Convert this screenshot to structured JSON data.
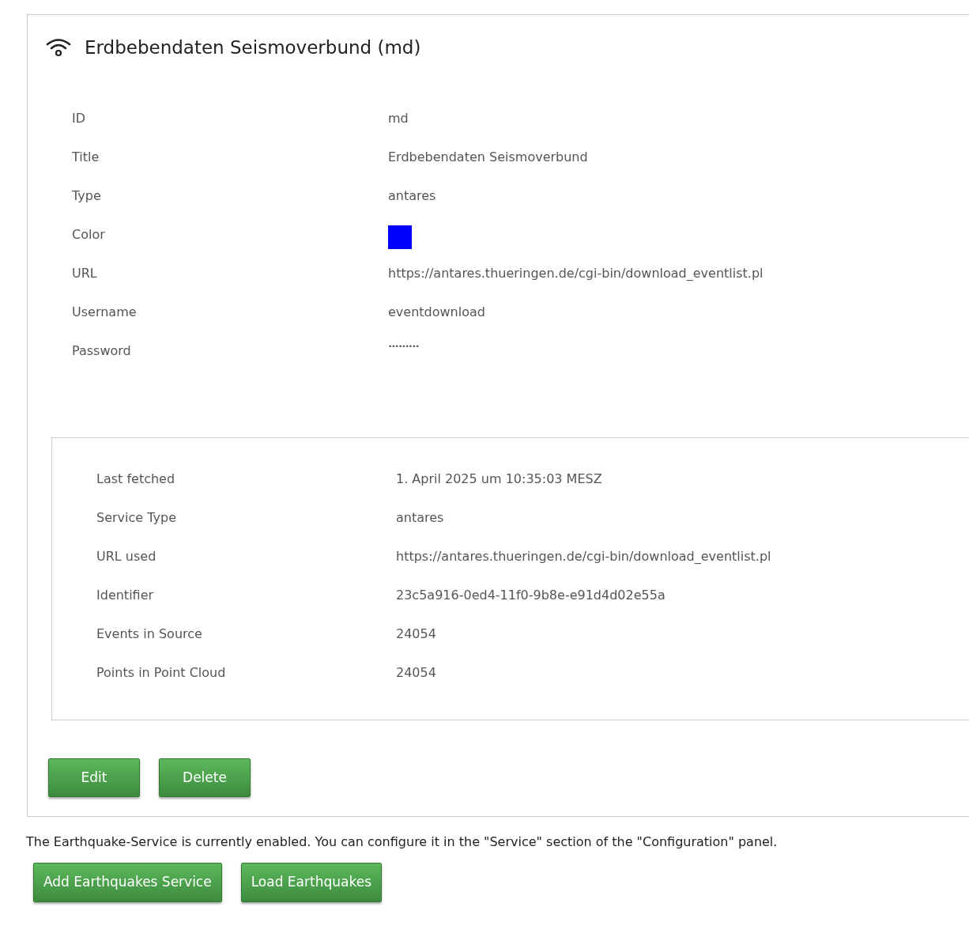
{
  "panel": {
    "title": "Erdbebendaten Seismoverbund (md)",
    "fields": [
      {
        "label": "ID",
        "value": "md",
        "kind": "text"
      },
      {
        "label": "Title",
        "value": "Erdbebendaten Seismoverbund",
        "kind": "text"
      },
      {
        "label": "Type",
        "value": "antares",
        "kind": "text"
      },
      {
        "label": "Color",
        "kind": "color",
        "color": "#0000ff"
      },
      {
        "label": "URL",
        "value": "https://antares.thueringen.de/cgi-bin/download_eventlist.pl",
        "kind": "text"
      },
      {
        "label": "Username",
        "value": "eventdownload",
        "kind": "text"
      },
      {
        "label": "Password",
        "value": "•••••••••",
        "kind": "password"
      }
    ],
    "status": [
      {
        "label": "Last fetched",
        "value": "1. April 2025 um 10:35:03 MESZ"
      },
      {
        "label": "Service Type",
        "value": "antares"
      },
      {
        "label": "URL used",
        "value": "https://antares.thueringen.de/cgi-bin/download_eventlist.pl"
      },
      {
        "label": "Identifier",
        "value": "23c5a916-0ed4-11f0-9b8e-e91d4d02e55a"
      },
      {
        "label": "Events in Source",
        "value": "24054"
      },
      {
        "label": "Points in Point Cloud",
        "value": "24054"
      }
    ],
    "buttons": [
      "Edit",
      "Delete"
    ]
  },
  "notice": "The Earthquake-Service is currently enabled. You can configure it in the \"Service\" section of the \"Configuration\" panel.",
  "buttons": [
    "Add Earthquakes Service",
    "Load Earthquakes"
  ]
}
